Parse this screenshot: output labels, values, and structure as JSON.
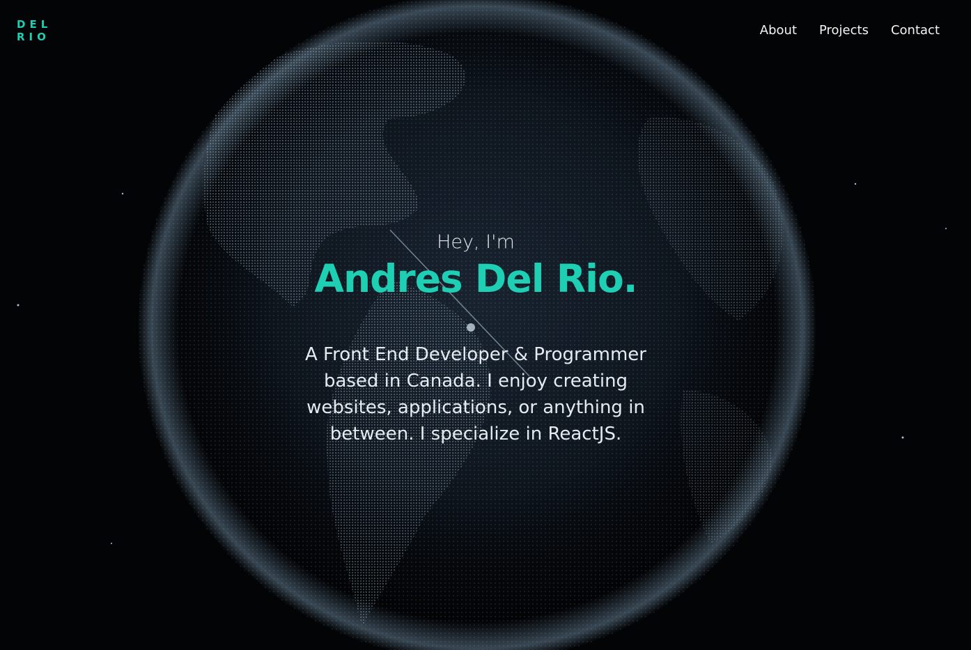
{
  "brand": {
    "logo_line1": "DEL",
    "logo_line2": "RIO",
    "accent_color": "#1ecfb3"
  },
  "nav": {
    "items": [
      {
        "label": "About"
      },
      {
        "label": "Projects"
      },
      {
        "label": "Contact"
      }
    ]
  },
  "hero": {
    "greeting": "Hey, I'm",
    "name": "Andres Del Rio.",
    "bio": "A Front End Developer & Programmer based in Canada. I enjoy creating websites, applications, or anything in between. I specialize in ReactJS.",
    "background_icon": "globe-particles-image"
  }
}
